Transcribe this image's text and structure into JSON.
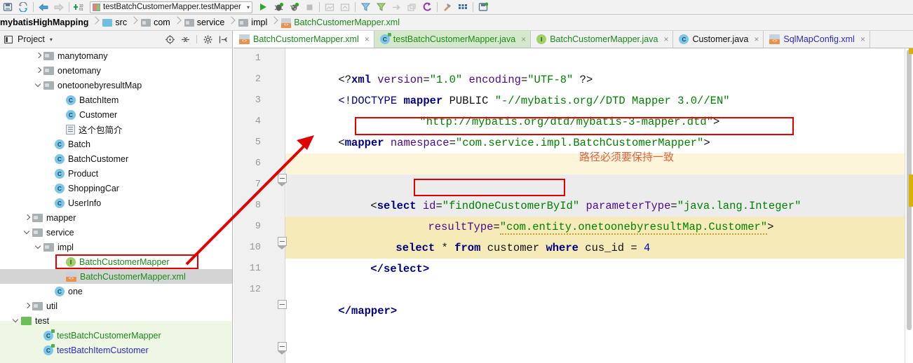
{
  "toolbar": {
    "icons": [
      "save-all-icon",
      "sync-icon",
      "undo-icon",
      "redo-icon",
      "settings-number-icon"
    ],
    "run_config": {
      "label": "testBatchCustomerMapper.testMapper",
      "chevron": "▾"
    },
    "right_icons": [
      "run-icon",
      "debug-icon",
      "coverage-icon",
      "stop-icon",
      "build-icon",
      "rebuild-icon",
      "attach-icon",
      "filter-icon",
      "step-icon",
      "restore-icon",
      "undo-purple-icon",
      "hammer-icon",
      "grid-icon",
      "save-disk-icon"
    ]
  },
  "breadcrumb": {
    "items": [
      {
        "label": "mybatisHighMapping",
        "icon": "project-icon",
        "kind": "project"
      },
      {
        "label": "src",
        "icon": "folder-blue-icon",
        "kind": "folder-blue"
      },
      {
        "label": "com",
        "icon": "folder-icon",
        "kind": "folder"
      },
      {
        "label": "service",
        "icon": "folder-icon",
        "kind": "folder"
      },
      {
        "label": "impl",
        "icon": "folder-icon",
        "kind": "folder"
      },
      {
        "label": "BatchCustomerMapper.xml",
        "icon": "xml-file-icon",
        "kind": "xml"
      }
    ]
  },
  "project_panel": {
    "title": "Project",
    "dropdown": "▾",
    "tools": [
      "locate-icon",
      "collapse-all-icon",
      "settings-gear-icon",
      "hide-icon"
    ],
    "tree": [
      {
        "label": "manytomany",
        "indent": 3,
        "twisty": "right",
        "icon": "folder-icon",
        "color": "black"
      },
      {
        "label": "onetomany",
        "indent": 3,
        "twisty": "right",
        "icon": "folder-icon",
        "color": "black"
      },
      {
        "label": "onetoonebyresultMap",
        "indent": 3,
        "twisty": "down",
        "icon": "folder-icon",
        "color": "black"
      },
      {
        "label": "BatchItem",
        "indent": 5,
        "twisty": "none",
        "icon": "class-icon",
        "color": "black"
      },
      {
        "label": "Customer",
        "indent": 5,
        "twisty": "none",
        "icon": "class-icon",
        "color": "black"
      },
      {
        "label": "这个包简介",
        "indent": 5,
        "twisty": "none",
        "icon": "text-file-icon",
        "color": "black"
      },
      {
        "label": "Batch",
        "indent": 4,
        "twisty": "none",
        "icon": "class-icon",
        "color": "black"
      },
      {
        "label": "BatchCustomer",
        "indent": 4,
        "twisty": "none",
        "icon": "class-icon",
        "color": "black"
      },
      {
        "label": "Product",
        "indent": 4,
        "twisty": "none",
        "icon": "class-icon",
        "color": "black"
      },
      {
        "label": "ShoppingCar",
        "indent": 4,
        "twisty": "none",
        "icon": "class-icon",
        "color": "black"
      },
      {
        "label": "UserInfo",
        "indent": 4,
        "twisty": "none",
        "icon": "class-icon",
        "color": "black"
      },
      {
        "label": "mapper",
        "indent": 2,
        "twisty": "right",
        "icon": "folder-icon",
        "color": "black"
      },
      {
        "label": "service",
        "indent": 2,
        "twisty": "down",
        "icon": "folder-icon",
        "color": "black"
      },
      {
        "label": "impl",
        "indent": 3,
        "twisty": "down",
        "icon": "folder-icon",
        "color": "black"
      },
      {
        "label": "BatchCustomerMapper",
        "indent": 5,
        "twisty": "none",
        "icon": "interface-icon",
        "color": "green",
        "boxed": true
      },
      {
        "label": "BatchCustomerMapper.xml",
        "indent": 5,
        "twisty": "none",
        "icon": "xml-file-icon",
        "color": "green",
        "selected": true
      },
      {
        "label": "one",
        "indent": 4,
        "twisty": "none",
        "icon": "class-icon",
        "color": "black"
      },
      {
        "label": "util",
        "indent": 2,
        "twisty": "right",
        "icon": "folder-icon",
        "color": "black"
      },
      {
        "label": "test",
        "indent": 1,
        "twisty": "down",
        "icon": "folder-green-icon",
        "color": "black",
        "testbg": true
      },
      {
        "label": "testBatchCustomerMapper",
        "indent": 3,
        "twisty": "none",
        "icon": "test-class-icon",
        "color": "green",
        "testbg": true
      },
      {
        "label": "testBatchItemCustomer",
        "indent": 3,
        "twisty": "none",
        "icon": "test-class-icon",
        "color": "blue",
        "testbg": true
      }
    ]
  },
  "editor_tabs": [
    {
      "label": "BatchCustomerMapper.xml",
      "icon": "xml-file-icon",
      "state": "active",
      "color": "green",
      "close": "×"
    },
    {
      "label": "testBatchCustomerMapper.java",
      "icon": "test-class-icon",
      "state": "green",
      "color": "green",
      "close": "×"
    },
    {
      "label": "BatchCustomerMapper.java",
      "icon": "interface-icon",
      "state": "normal",
      "color": "green",
      "close": "×"
    },
    {
      "label": "Customer.java",
      "icon": "class-icon",
      "state": "normal",
      "color": "black",
      "close": "×"
    },
    {
      "label": "SqlMapConfig.xml",
      "icon": "xml-file-icon",
      "state": "normal",
      "color": "blue",
      "close": "×"
    }
  ],
  "editor": {
    "line_numbers": [
      "1",
      "2",
      "3",
      "4",
      "5",
      "6",
      "7",
      "8",
      "9",
      "10",
      "11",
      "12"
    ],
    "lines": {
      "l1": {
        "prolog_open": "<?",
        "tag": "xml",
        "sp1": " ",
        "a1": "version",
        "eq1": "=",
        "v1": "\"1.0\"",
        "sp2": " ",
        "a2": "encoding",
        "eq2": "=",
        "v2": "\"UTF-8\"",
        "close": " ?>"
      },
      "l2": {
        "doctype": "<!DOCTYPE",
        "name": "mapper",
        "public": "PUBLIC",
        "id": "\"-//mybatis.org//DTD Mapper 3.0//EN\""
      },
      "l3": {
        "sysid": "\"http://mybatis.org/dtd/mybatis-3-mapper.dtd\"",
        "close": ">"
      },
      "l4": {
        "open": "<",
        "tag": "mapper",
        "attr": "namespace",
        "eq": "=",
        "value": "\"com.service.impl.BatchCustomerMapper\"",
        "close": ">"
      },
      "l7": {
        "open": "<",
        "tag": "select",
        "a1": "id",
        "eq1": "=",
        "q1": "\"",
        "v1": "findOneCustomerById",
        "q1b": "\"",
        "a2": "parameterType",
        "eq2": "=",
        "v2": "\"java.lang.Integer\""
      },
      "l8": {
        "a3": "resultType",
        "eq3": "=",
        "v3": "\"com.entity.onetoonebyresultMap.Customer\"",
        "close": ">"
      },
      "l9": {
        "kw1": "select",
        "star": "*",
        "kw2": "from",
        "tbl": "customer",
        "kw3": "where",
        "col": "cus_id",
        "op": "=",
        "num": "4"
      },
      "l10": {
        "text": "</select>"
      },
      "l12": {
        "text": "</mapper>"
      }
    }
  },
  "annotations": {
    "chinese_note": "路径必须要保持一致",
    "colors": {
      "box": "#e00000",
      "arrow": "#e00000",
      "note": "#e0603a"
    }
  }
}
